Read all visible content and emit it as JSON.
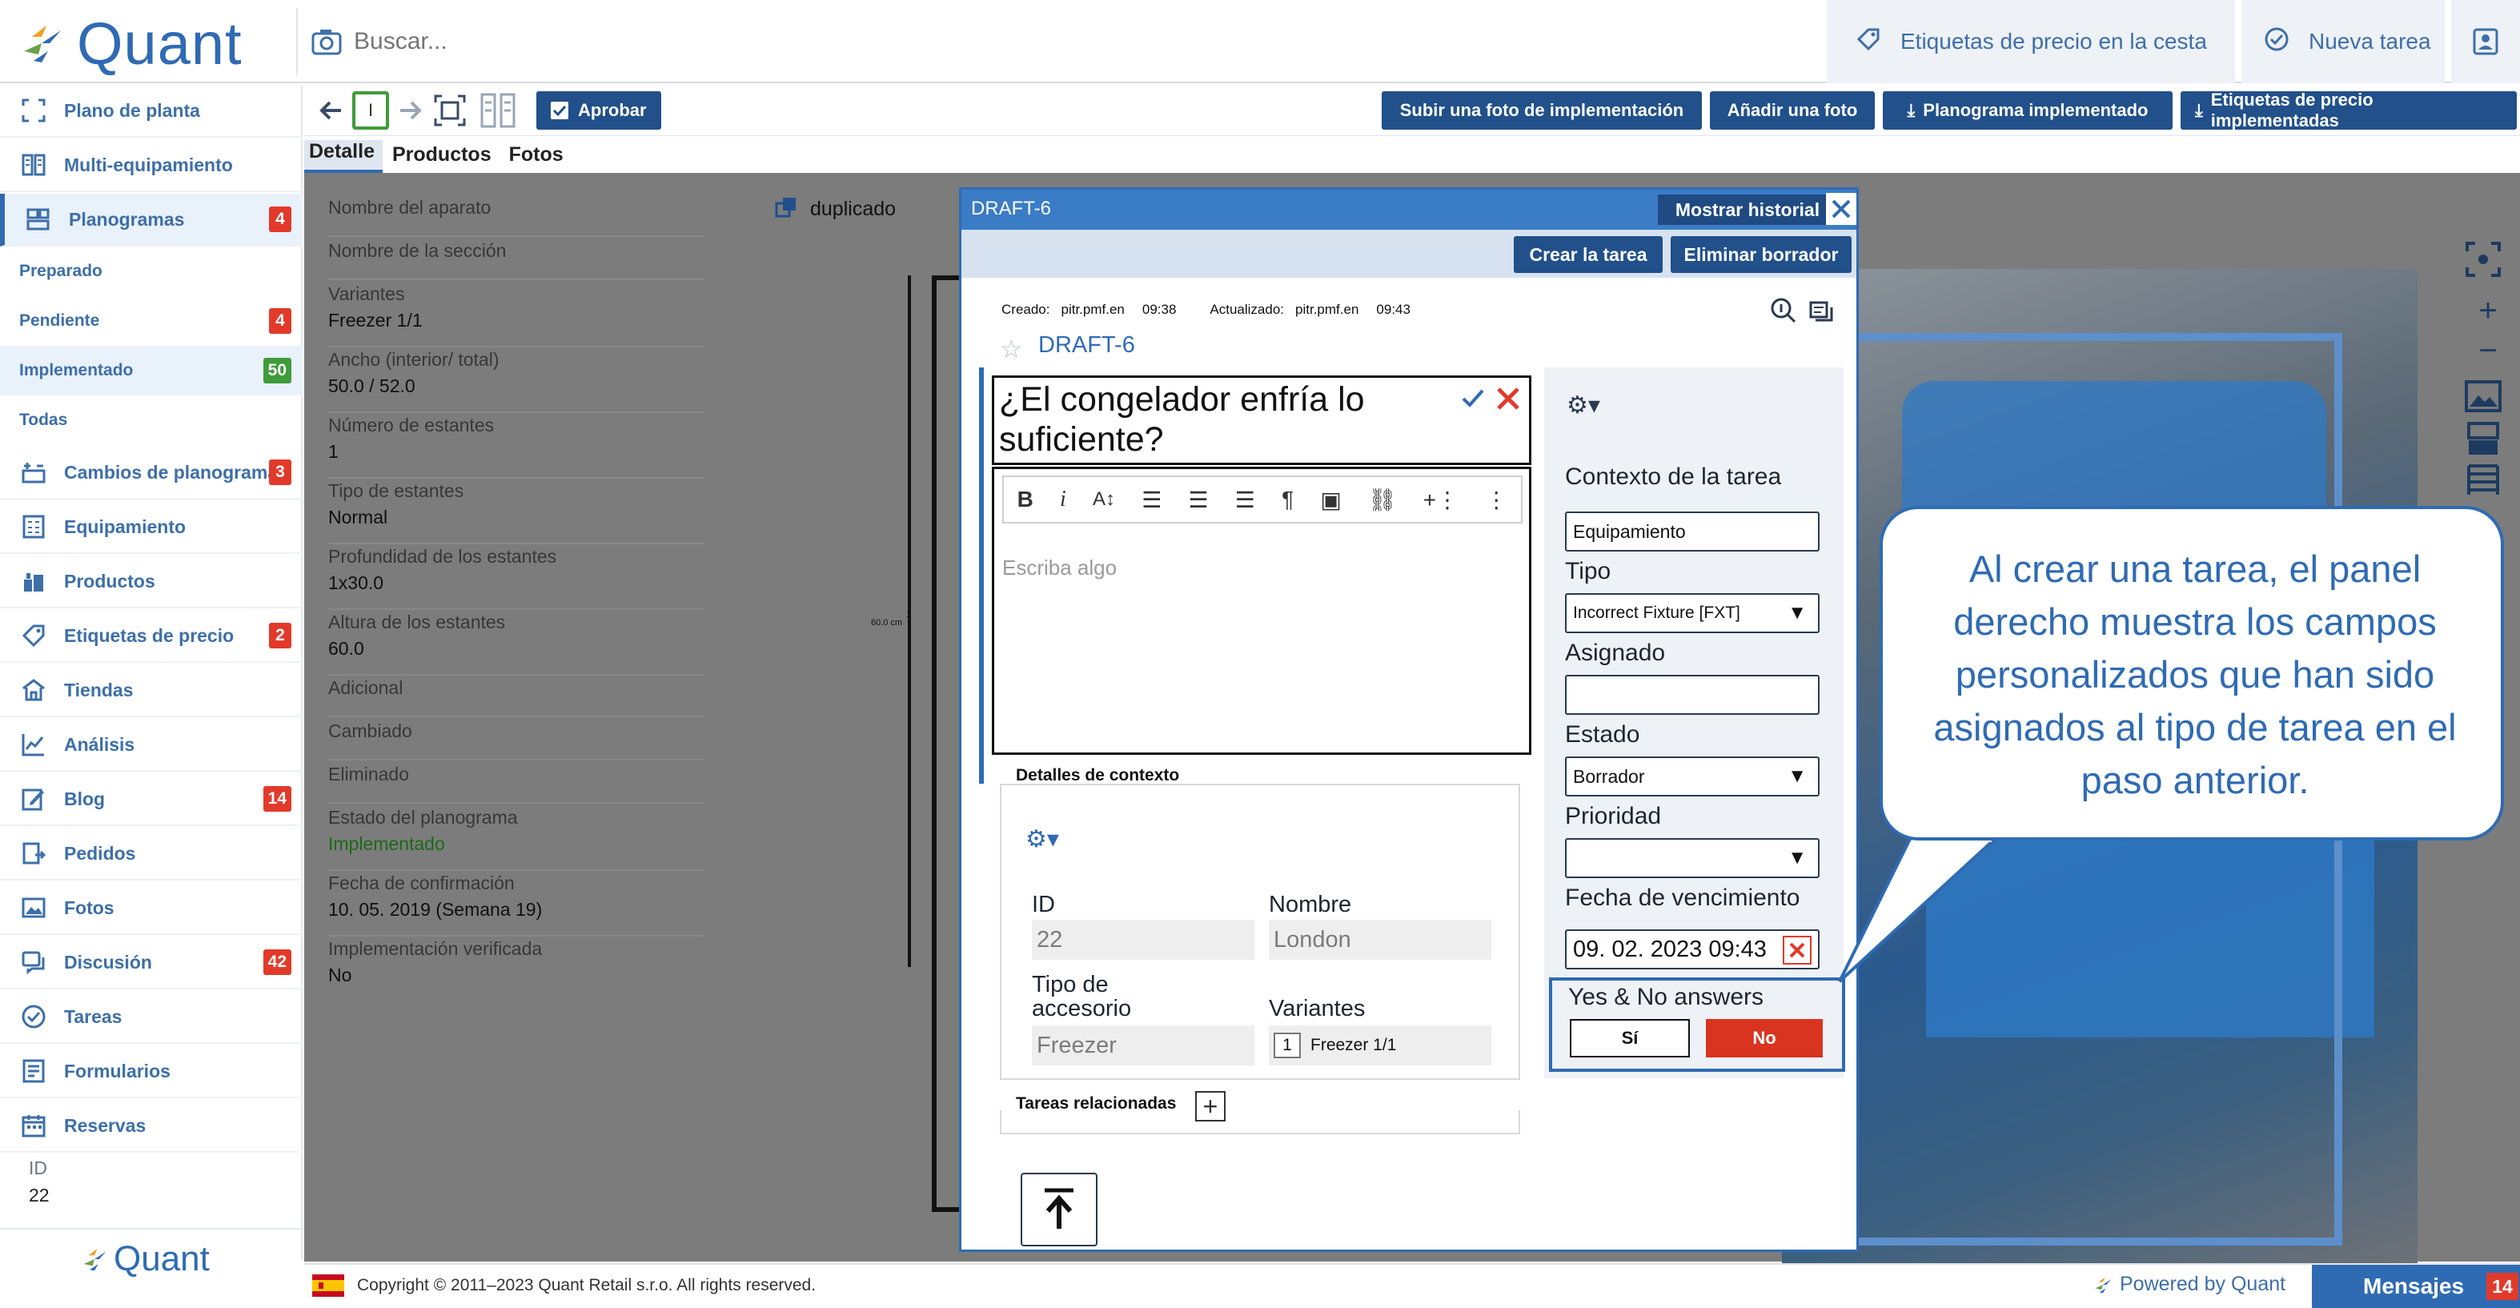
{
  "app": {
    "brand": "Quant",
    "footer_brand": "Quant"
  },
  "search": {
    "placeholder": "Buscar..."
  },
  "header": {
    "price_tags_cart": "Etiquetas de precio en la cesta",
    "new_task": "Nueva tarea"
  },
  "sidebar": {
    "items": [
      {
        "label": "Plano de planta",
        "icon": "floorplan-icon"
      },
      {
        "label": "Multi-equipamiento",
        "icon": "multi-equipment-icon"
      },
      {
        "label": "Planogramas",
        "icon": "planogram-icon",
        "badge": "4"
      },
      {
        "label": "Cambios de planograma",
        "icon": "planogram-changes-icon",
        "badge": "3"
      },
      {
        "label": "Equipamiento",
        "icon": "equipment-icon"
      },
      {
        "label": "Productos",
        "icon": "products-icon"
      },
      {
        "label": "Etiquetas de precio",
        "icon": "price-tag-icon",
        "badge": "2"
      },
      {
        "label": "Tiendas",
        "icon": "store-icon"
      },
      {
        "label": "Análisis",
        "icon": "analytics-icon"
      },
      {
        "label": "Blog",
        "icon": "blog-icon",
        "badge": "14"
      },
      {
        "label": "Pedidos",
        "icon": "orders-icon"
      },
      {
        "label": "Fotos",
        "icon": "photos-icon"
      },
      {
        "label": "Discusión",
        "icon": "discussion-icon",
        "badge": "42"
      },
      {
        "label": "Tareas",
        "icon": "tasks-icon"
      },
      {
        "label": "Formularios",
        "icon": "forms-icon"
      },
      {
        "label": "Reservas",
        "icon": "reservations-icon"
      }
    ],
    "sub": [
      {
        "label": "Preparado"
      },
      {
        "label": "Pendiente",
        "badge": "4"
      },
      {
        "label": "Implementado",
        "badge": "50"
      },
      {
        "label": "Todas"
      }
    ],
    "id_label": "ID",
    "id_value": "22"
  },
  "toolbar": {
    "page_indicator": "I",
    "approve": "Aprobar",
    "upload_photo": "Subir una foto de implementación",
    "add_photo": "Añadir una foto",
    "planogram_implemented": "Planograma implementado",
    "price_tags_implemented": "Etiquetas de precio implementadas"
  },
  "tabs": [
    "Detalle",
    "Productos",
    "Fotos"
  ],
  "details": [
    {
      "label": "Nombre del aparato",
      "value": ""
    },
    {
      "label": "Nombre de la sección",
      "value": ""
    },
    {
      "label": "Variantes",
      "value": "Freezer 1/1"
    },
    {
      "label": "Ancho (interior/ total)",
      "value": "50.0 / 52.0"
    },
    {
      "label": "Número de estantes",
      "value": "1"
    },
    {
      "label": "Tipo de estantes",
      "value": "Normal"
    },
    {
      "label": "Profundidad de los estantes",
      "value": "1x30.0"
    },
    {
      "label": "Altura de los estantes",
      "value": "60.0"
    },
    {
      "label": "Adicional",
      "value": ""
    },
    {
      "label": "Cambiado",
      "value": ""
    },
    {
      "label": "Eliminado",
      "value": ""
    },
    {
      "label": "Estado del planograma",
      "value": "Implementado"
    },
    {
      "label": "Fecha de confirmación",
      "value": "10. 05. 2019 (Semana 19)"
    },
    {
      "label": "Implementación verificada",
      "value": "No"
    }
  ],
  "canvas": {
    "duplicate": "duplicado",
    "dimension": "60.0 cm",
    "dimension_tick": "1"
  },
  "modal": {
    "title": "DRAFT-6",
    "show_history": "Mostrar historial",
    "create_task": "Crear la tarea",
    "delete_draft": "Eliminar borrador",
    "created_label": "Creado:",
    "created_by": "pitr.pmf.en",
    "created_time": "09:38",
    "updated_label": "Actualizado:",
    "updated_by": "pitr.pmf.en",
    "updated_time": "09:43",
    "draft_name": "DRAFT-6",
    "question": "¿El congelador enfría lo suficiente?",
    "editor_placeholder": "Escriba algo",
    "context_details": "Detalles de contexto",
    "ctx": {
      "id_label": "ID",
      "id_value": "22",
      "name_label": "Nombre",
      "name_value": "London",
      "accessory_label": "Tipo de accesorio",
      "accessory_value": "Freezer",
      "variants_label": "Variantes",
      "variants_count": "1",
      "variants_value": "Freezer 1/1"
    },
    "related_tasks": "Tareas relacionadas",
    "right": {
      "context_label": "Contexto de la tarea",
      "context_value": "Equipamiento",
      "type_label": "Tipo",
      "type_value": "Incorrect Fixture [FXT]",
      "assigned_label": "Asignado",
      "assigned_value": "",
      "status_label": "Estado",
      "status_value": "Borrador",
      "priority_label": "Prioridad",
      "priority_value": "",
      "due_label": "Fecha de vencimiento",
      "due_value": "09. 02. 2023 09:43",
      "yn_label": "Yes & No answers",
      "yes": "Sí",
      "no": "No"
    }
  },
  "bubble": "Al crear una tarea, el panel derecho muestra los campos personalizados que han sido asignados al tipo de tarea en el paso anterior.",
  "footer": {
    "copyright": "Copyright © 2011–2023 Quant Retail s.r.o. All rights reserved.",
    "powered": "Powered by Quant",
    "messages": "Mensajes",
    "messages_count": "14"
  },
  "colors": {
    "brand": "#2f6bb3",
    "dark": "#21508a",
    "badge": "#e23a2a",
    "success": "#3f9b3a"
  }
}
